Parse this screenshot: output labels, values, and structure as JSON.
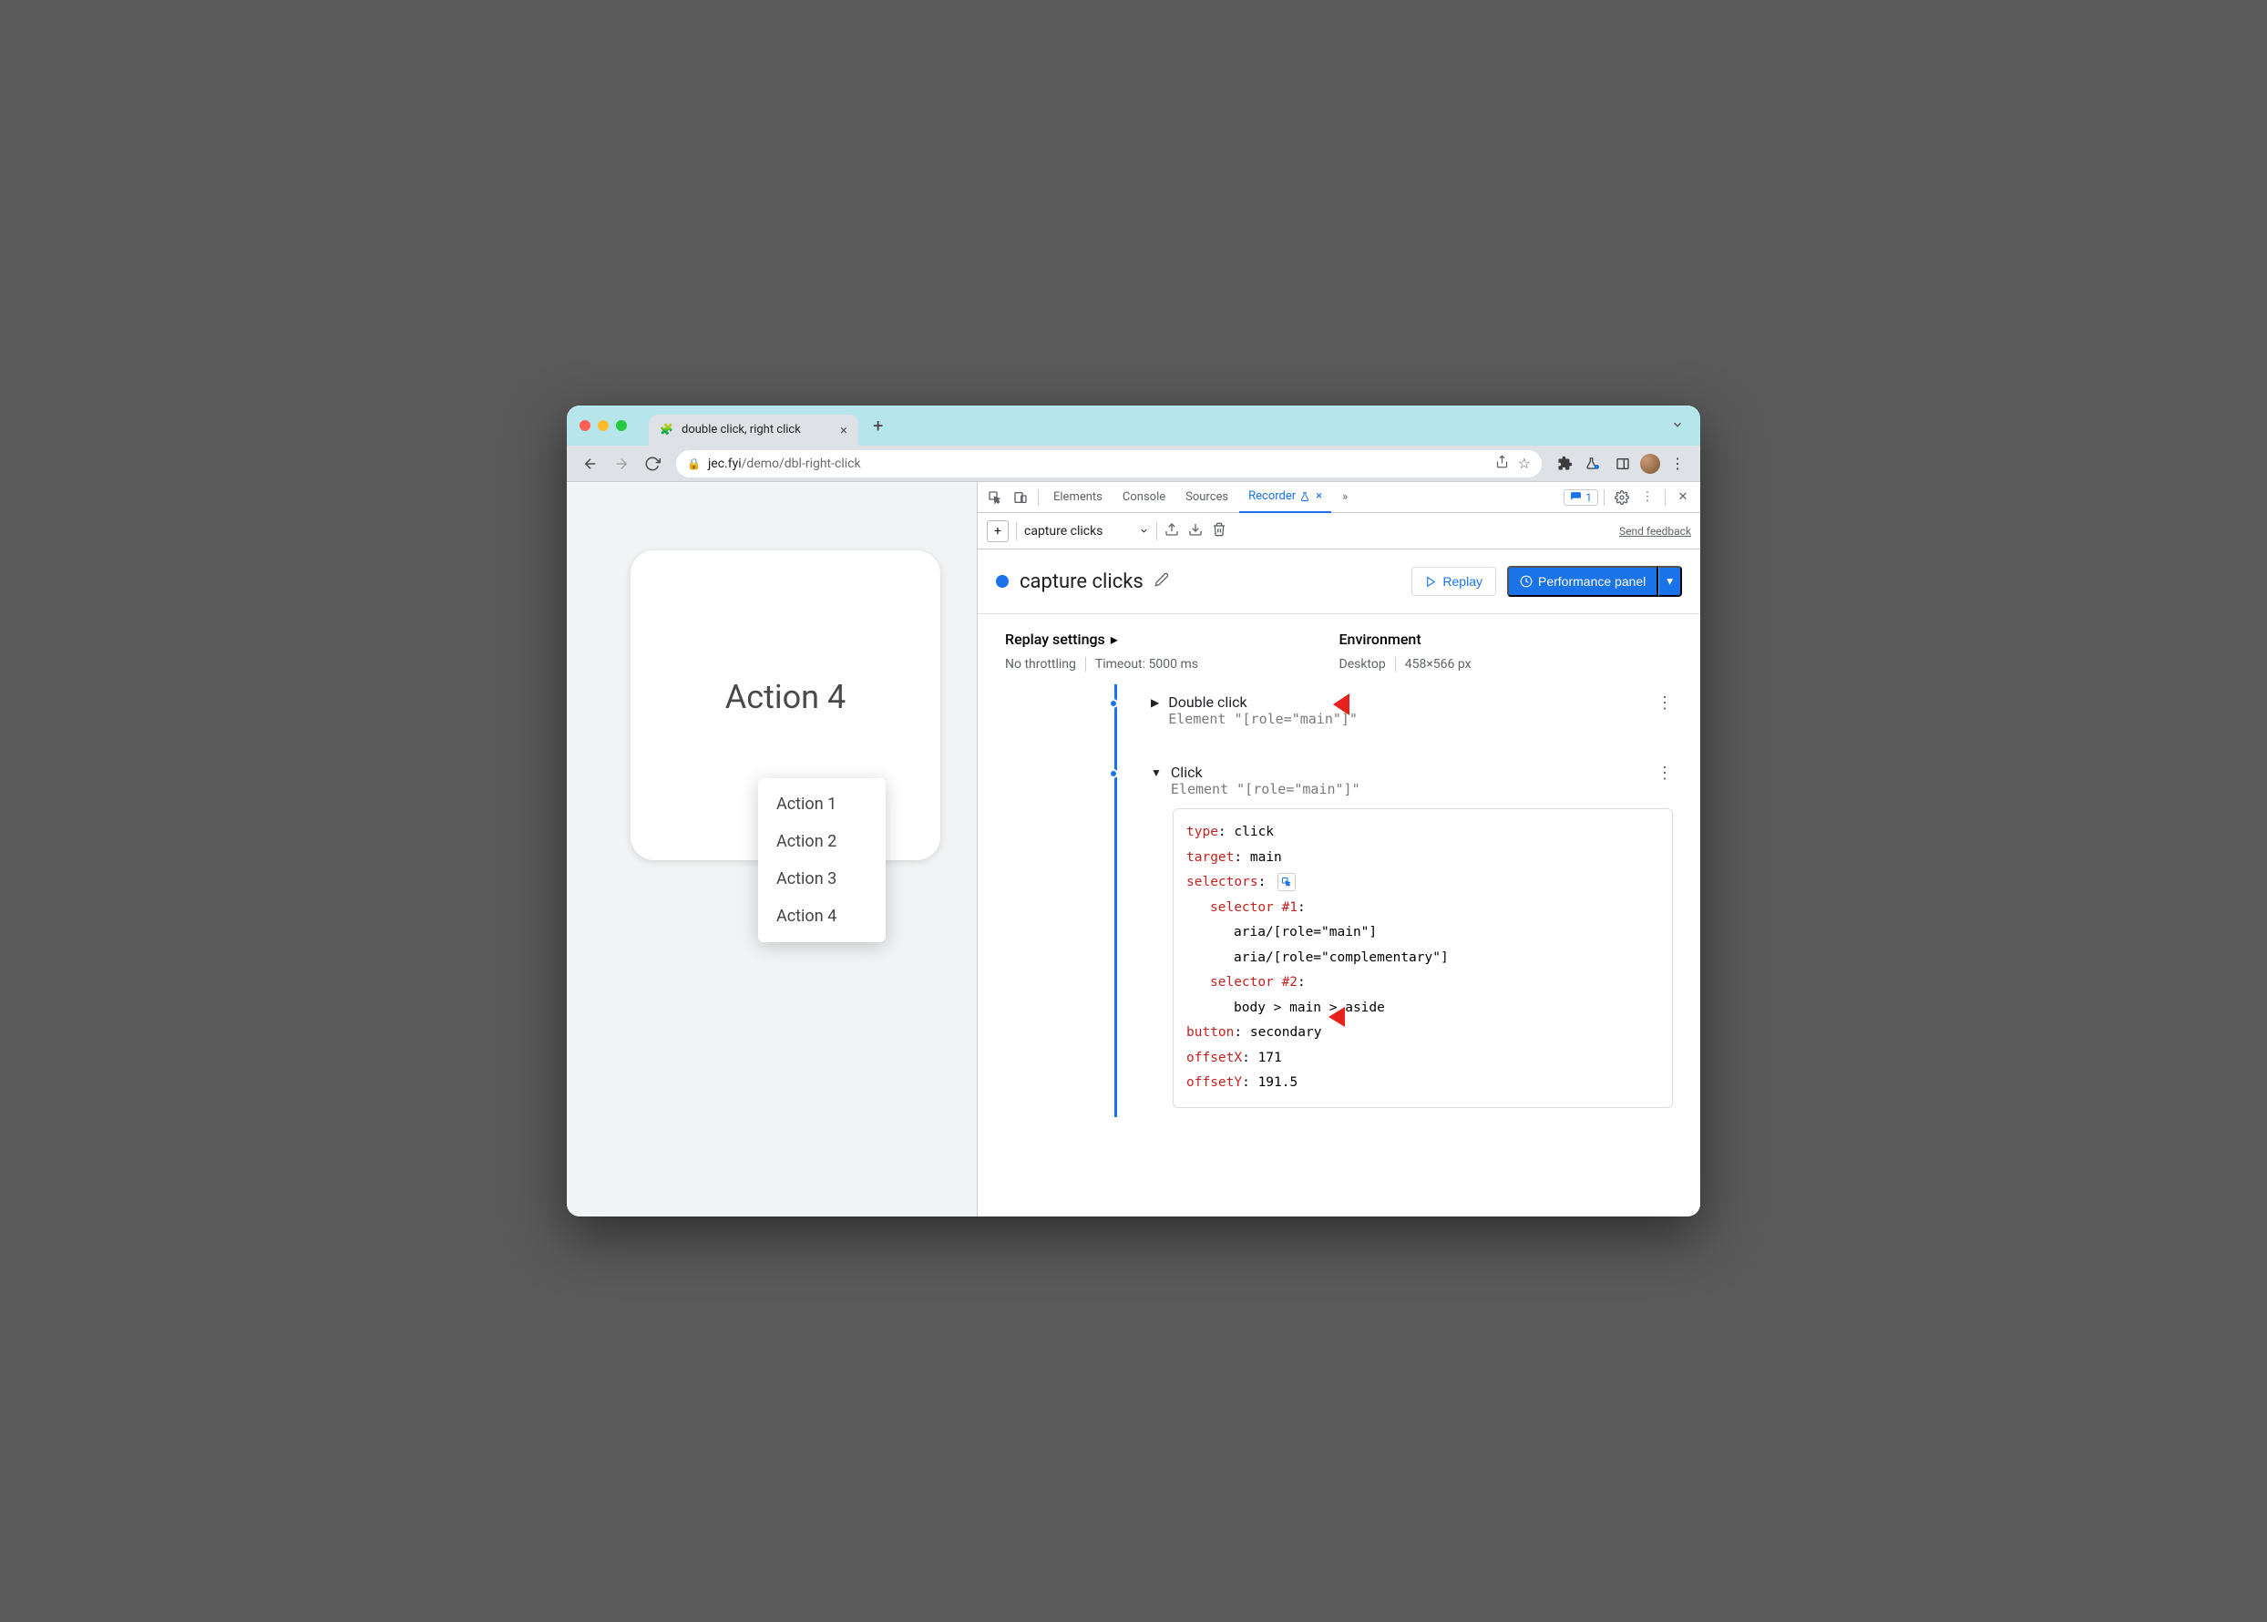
{
  "browser": {
    "tab_title": "double click, right click",
    "url_host": "jec.fyi",
    "url_path": "/demo/dbl-right-click"
  },
  "page": {
    "card_title": "Action 4",
    "context_menu": [
      "Action 1",
      "Action 2",
      "Action 3",
      "Action 4"
    ]
  },
  "devtools": {
    "tabs": {
      "elements": "Elements",
      "console": "Console",
      "sources": "Sources",
      "recorder": "Recorder",
      "issues_count": "1"
    },
    "recorder": {
      "toolbar": {
        "recording_select": "capture clicks",
        "feedback": "Send feedback"
      },
      "header": {
        "title": "capture clicks",
        "replay_btn": "Replay",
        "perf_btn": "Performance panel"
      },
      "settings": {
        "replay_label": "Replay settings",
        "throttling": "No throttling",
        "timeout": "Timeout: 5000 ms",
        "env_label": "Environment",
        "device": "Desktop",
        "viewport": "458×566 px"
      },
      "steps": [
        {
          "title": "Double click",
          "subtitle": "Element \"[role=\"main\"]\"",
          "expanded": false
        },
        {
          "title": "Click",
          "subtitle": "Element \"[role=\"main\"]\"",
          "expanded": true,
          "details": {
            "type": "click",
            "target": "main",
            "selectors_label": "selectors",
            "selector1_label": "selector #1",
            "selector1_a": "aria/[role=\"main\"]",
            "selector1_b": "aria/[role=\"complementary\"]",
            "selector2_label": "selector #2",
            "selector2_a": "body > main > aside",
            "button": "secondary",
            "offsetX": "171",
            "offsetY": "191.5"
          }
        }
      ]
    }
  }
}
